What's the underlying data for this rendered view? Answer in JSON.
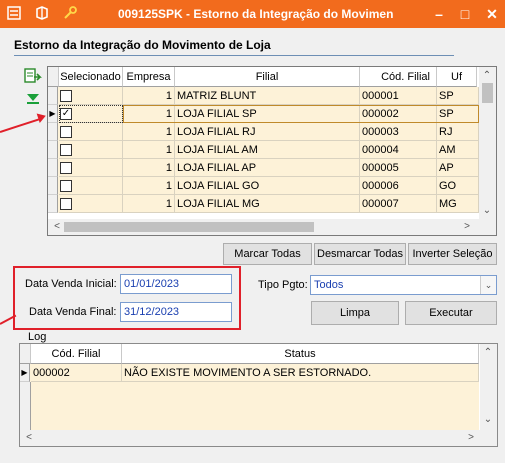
{
  "window": {
    "title": "009125SPK - Estorno da Integração do Movimen",
    "icons": [
      "app-menu-icon",
      "module-icon",
      "key-icon"
    ],
    "controls": [
      "minimize-icon",
      "maximize-icon",
      "close-icon"
    ]
  },
  "heading": "Estorno da Integração do Movimento de Loja",
  "stores_grid": {
    "columns": [
      "Selecionado",
      "Empresa",
      "Filial",
      "Cód. Filial",
      "Uf"
    ],
    "rows": [
      {
        "selected": false,
        "empresa": "1",
        "filial": "MATRIZ BLUNT",
        "cod": "000001",
        "uf": "SP",
        "current": false
      },
      {
        "selected": true,
        "empresa": "1",
        "filial": "LOJA FILIAL SP",
        "cod": "000002",
        "uf": "SP",
        "current": true
      },
      {
        "selected": false,
        "empresa": "1",
        "filial": "LOJA FILIAL RJ",
        "cod": "000003",
        "uf": "RJ",
        "current": false
      },
      {
        "selected": false,
        "empresa": "1",
        "filial": "LOJA FILIAL AM",
        "cod": "000004",
        "uf": "AM",
        "current": false
      },
      {
        "selected": false,
        "empresa": "1",
        "filial": "LOJA FILIAL AP",
        "cod": "000005",
        "uf": "AP",
        "current": false
      },
      {
        "selected": false,
        "empresa": "1",
        "filial": "LOJA FILIAL GO",
        "cod": "000006",
        "uf": "GO",
        "current": false
      },
      {
        "selected": false,
        "empresa": "1",
        "filial": "LOJA FILIAL MG",
        "cod": "000007",
        "uf": "MG",
        "current": false
      }
    ]
  },
  "selection_buttons": {
    "mark_all": "Marcar Todas",
    "unmark_all": "Desmarcar Todas",
    "invert": "Inverter Seleção"
  },
  "filters": {
    "date_start_label": "Data Venda Inicial:",
    "date_start_value": "01/01/2023",
    "date_end_label": "Data Venda Final:",
    "date_end_value": "31/12/2023",
    "payment_type_label": "Tipo Pgto:",
    "payment_type_value": "Todos"
  },
  "actions": {
    "clear": "Limpa",
    "execute": "Executar"
  },
  "log": {
    "label": "Log",
    "columns": [
      "Cód. Filial",
      "Status"
    ],
    "rows": [
      {
        "cod": "000002",
        "status": "NÃO EXISTE MOVIMENTO A SER ESTORNADO."
      }
    ]
  },
  "colors": {
    "titlebar": "#f26b1d",
    "highlight": "#e0202a",
    "grid_row": "#fdf2d8",
    "field_text": "#1a3fb0"
  }
}
